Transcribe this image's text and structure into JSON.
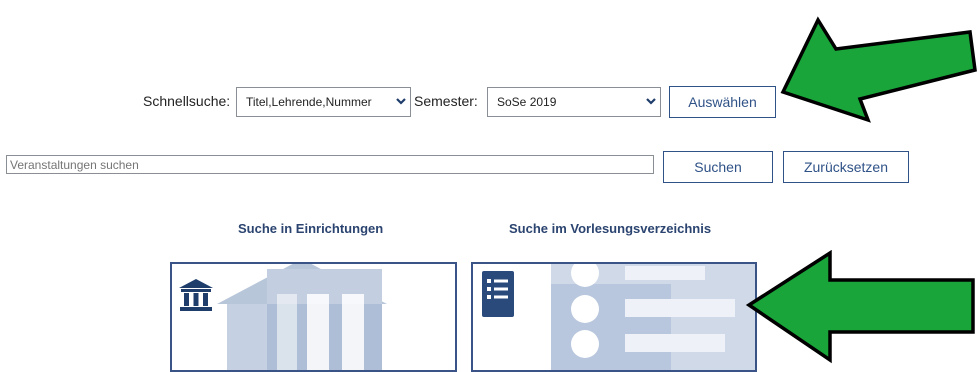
{
  "quick_search": {
    "label": "Schnellsuche:",
    "mode_value": "Titel,Lehrende,Nummer",
    "semester_label": "Semester:",
    "semester_value": "SoSe 2019",
    "choose_button": "Auswählen"
  },
  "search": {
    "placeholder": "Veranstaltungen suchen",
    "search_button": "Suchen",
    "reset_button": "Zurücksetzen"
  },
  "tiles": [
    {
      "title": "Suche in Einrichtungen",
      "icon": "institution-icon"
    },
    {
      "title": "Suche im Vorlesungsverzeichnis",
      "icon": "list-icon"
    }
  ],
  "annotations": {
    "arrow_color": "#19a53a",
    "arrow_outline": "#000000"
  }
}
